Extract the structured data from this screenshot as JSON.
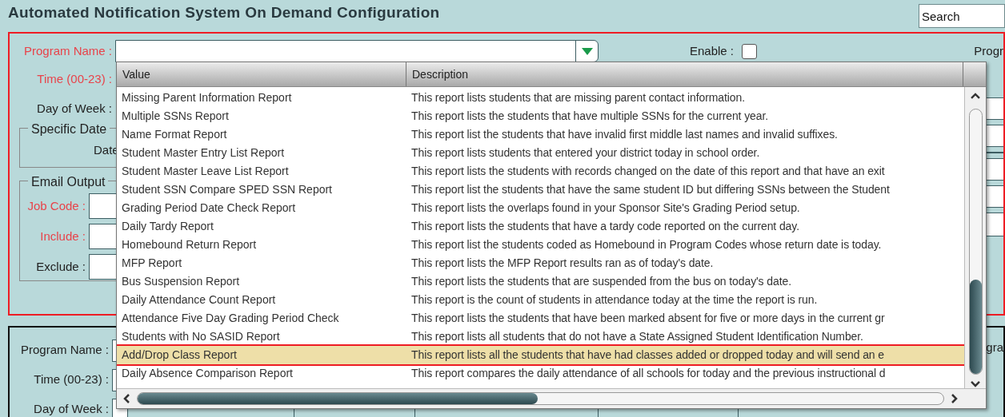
{
  "title": "Automated Notification System On Demand Configuration",
  "search": {
    "placeholder": "Search"
  },
  "config_panel": {
    "program_name_label": "Program Name :",
    "enable_label": "Enable :",
    "enable_checked": false,
    "program_cut_label": "Progr",
    "fields": [
      {
        "label": "Time (00-23) :",
        "required": true
      },
      {
        "label": "Day of Week :",
        "required": false
      }
    ],
    "specific_date": {
      "legend": "Specific Date",
      "date_label": "Date"
    },
    "email_output": {
      "legend": "Email Output",
      "fields": [
        {
          "label": "Job Code :",
          "required": true
        },
        {
          "label": "Include :",
          "required": true
        },
        {
          "label": "Exclude :",
          "required": false
        }
      ]
    }
  },
  "lower_panel": {
    "fields": [
      {
        "label": "Program Name :"
      },
      {
        "label": "Time (00-23) :"
      },
      {
        "label": "Day of Week :"
      }
    ],
    "program_cut_label": "gra"
  },
  "dropdown": {
    "columns": [
      "Value",
      "Description"
    ],
    "rows": [
      {
        "value": "Missing Parent Information Report",
        "description": "This report lists students that are missing parent contact information.",
        "selected": false
      },
      {
        "value": "Multiple SSNs Report",
        "description": "This report lists the students that have multiple SSNs for the current year.",
        "selected": false
      },
      {
        "value": "Name Format Report",
        "description": "This report list the students that have invalid first middle last names and invalid suffixes.",
        "selected": false
      },
      {
        "value": "Student Master Entry List Report",
        "description": "This report lists students that entered your district today in school order.",
        "selected": false
      },
      {
        "value": "Student Master Leave List Report",
        "description": "This report lists the students with records changed on the date of this report and that have an exit",
        "selected": false
      },
      {
        "value": "Student SSN Compare SPED SSN Report",
        "description": "This report list the students that have the same student ID but differing SSNs between the Student",
        "selected": false
      },
      {
        "value": "Grading Period Date Check Report",
        "description": "This report lists the overlaps found in your Sponsor Site's Grading Period setup.",
        "selected": false
      },
      {
        "value": "Daily Tardy Report",
        "description": "This report lists the students that have a tardy code reported on the current day.",
        "selected": false
      },
      {
        "value": "Homebound Return Report",
        "description": "This report list the students coded as Homebound in Program Codes whose return date is today.",
        "selected": false
      },
      {
        "value": "MFP Report",
        "description": "This report lists the MFP Report results ran as of today's date.",
        "selected": false
      },
      {
        "value": "Bus Suspension Report",
        "description": "This report lists the students that are suspended from the bus on today's date.",
        "selected": false
      },
      {
        "value": "Daily Attendance Count Report",
        "description": "This report is the count of students in attendance today at the time the report is run.",
        "selected": false
      },
      {
        "value": "Attendance Five Day Grading Period Check",
        "description": "This report lists the students that have been marked absent for five or more days in the current gr",
        "selected": false
      },
      {
        "value": "Students with No SASID Report",
        "description": "This report lists all students that do not have a State Assigned Student Identification Number.",
        "selected": false
      },
      {
        "value": "Add/Drop Class Report",
        "description": "This report lists all the students that have had classes added or dropped today and will send an e",
        "selected": true
      },
      {
        "value": "Daily Absence Comparison Report",
        "description": "This report compares the daily attendance of all schools for today and the previous instructional d",
        "selected": false
      }
    ]
  }
}
